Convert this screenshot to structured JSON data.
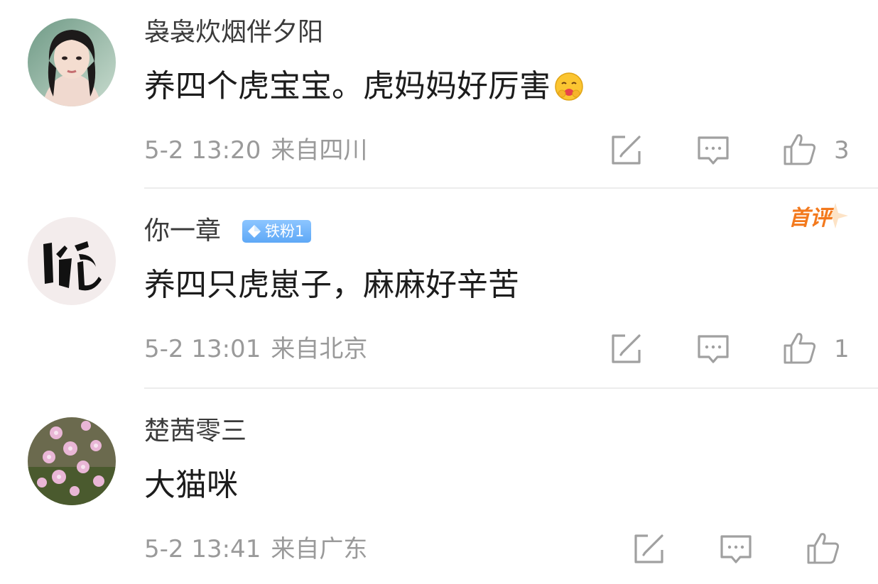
{
  "comments": [
    {
      "username": "袅袅炊烟伴夕阳",
      "text": "养四个虎宝宝。虎妈妈好厉害",
      "emoji": "hugging-face-emoji",
      "time": "5-2 13:20",
      "location": "来自四川",
      "likes": "3"
    },
    {
      "username": "你一章",
      "badge": "铁粉1",
      "first_tag": "首评",
      "text": "养四只虎崽子，麻麻好辛苦",
      "time": "5-2 13:01",
      "location": "来自北京",
      "likes": "1"
    },
    {
      "username": "楚茜零三",
      "text": "大猫咪",
      "time": "5-2 13:41",
      "location": "来自广东",
      "likes": ""
    }
  ],
  "icons": {
    "share": "share-icon",
    "reply": "comment-icon",
    "like": "thumbs-up-icon"
  },
  "colors": {
    "badge_blue": "#5ea8f6",
    "first_tag_orange": "#f3791d",
    "meta_gray": "#9a9a9a"
  }
}
